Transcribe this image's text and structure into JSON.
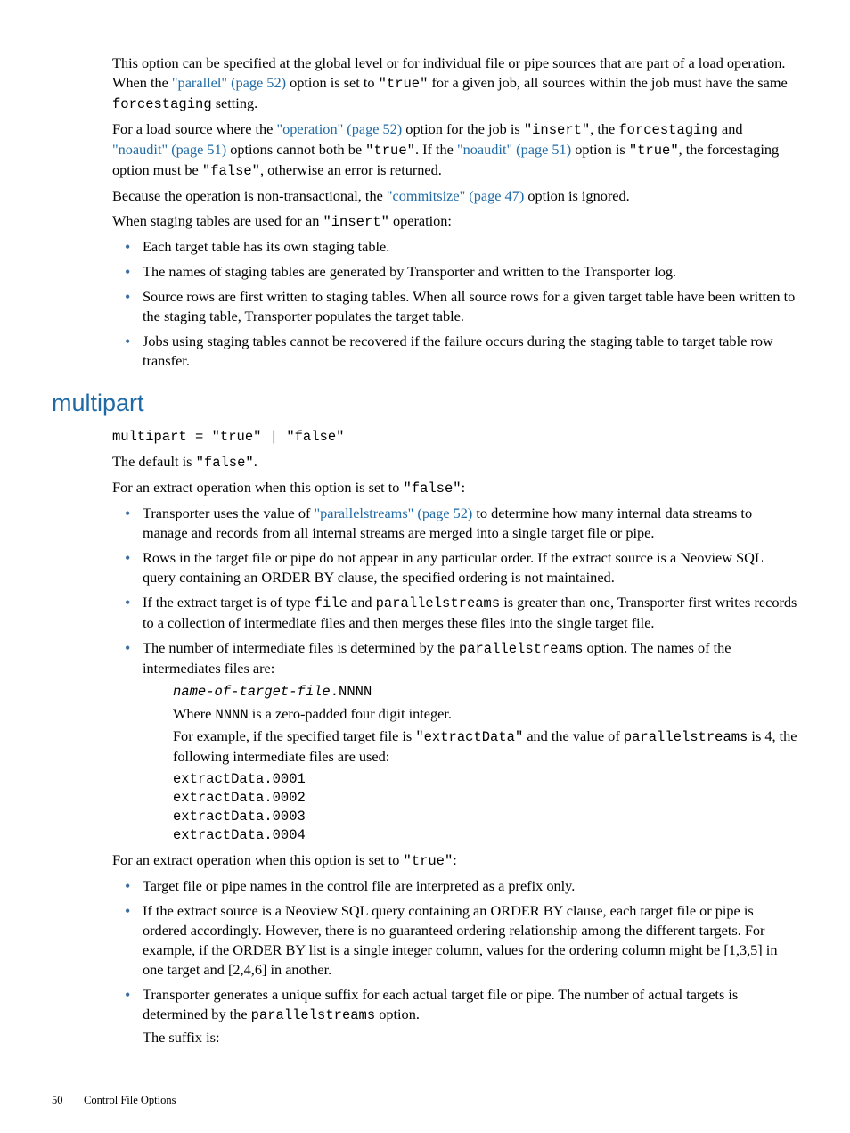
{
  "para1": {
    "t1": "This option can be specified at the global level or for individual file or pipe sources that are part of a load operation. When the ",
    "link1": "\"parallel\" (page 52)",
    "t2": " option is set to ",
    "code1": "\"true\"",
    "t3": " for a given job, all sources within the job must have the same ",
    "code2": "forcestaging",
    "t4": " setting."
  },
  "para2": {
    "t1": "For a load source where the ",
    "link1": "\"operation\" (page 52)",
    "t2": " option for the job is ",
    "code1": "\"insert\"",
    "t3": ", the ",
    "code2": "forcestaging",
    "t4": " and ",
    "link2": "\"noaudit\" (page 51)",
    "t5": " options cannot both be ",
    "code3": "\"true\"",
    "t6": ". If the ",
    "link3": "\"noaudit\" (page 51)",
    "t7": " option is ",
    "code4": "\"true\"",
    "t8": ", the forcestaging option must be ",
    "code5": "\"false\"",
    "t9": ", otherwise an error is returned."
  },
  "para3": {
    "t1": "Because the operation is non-transactional, the ",
    "link1": "\"commitsize\" (page 47)",
    "t2": " option is ignored."
  },
  "para4": {
    "t1": "When staging tables are used for an ",
    "code1": "\"insert\"",
    "t2": " operation:"
  },
  "list1": {
    "i1": "Each target table has its own staging table.",
    "i2": "The names of staging tables are generated by Transporter and written to the Transporter log.",
    "i3": "Source rows are first written to staging tables. When all source rows for a given target table have been written to the staging table, Transporter populates the target table.",
    "i4": "Jobs using staging tables cannot be recovered if the failure occurs during the staging table to target table row transfer."
  },
  "section_heading": "multipart",
  "syntax": "multipart = \"true\" | \"false\"",
  "default": {
    "t1": "The default is ",
    "code1": "\"false\"",
    "t2": "."
  },
  "false_intro": {
    "t1": "For an extract operation when this option is set to ",
    "code1": "\"false\"",
    "t2": ":"
  },
  "list2": {
    "i1": {
      "t1": "Transporter uses the value of ",
      "link1": "\"parallelstreams\" (page 52)",
      "t2": " to determine how many internal data streams to manage and records from all internal streams are merged into a single target file or pipe."
    },
    "i2": "Rows in the target file or pipe do not appear in any particular order. If the extract source is a Neoview SQL query containing an ORDER BY clause, the specified ordering is not maintained.",
    "i3": {
      "t1": "If the extract target is of type ",
      "c1": "file",
      "t2": " and ",
      "c2": "parallelstreams",
      "t3": " is greater than one, Transporter first writes records to a collection of intermediate files and then merges these files into the single target file."
    },
    "i4": {
      "t1": "The number of intermediate files is determined by the ",
      "c1": "parallelstreams",
      "t2": " option. The names of the intermediates files are:"
    }
  },
  "name_pattern_prefix": "name-of-target-file",
  "name_pattern_suffix": ".NNNN",
  "where_line": {
    "t1": "Where ",
    "c1": "NNNN",
    "t2": " is a zero-padded four digit integer."
  },
  "example_intro": {
    "t1": "For example, if the specified target file is ",
    "c1": "\"extractData\"",
    "t2": " and the value of ",
    "c2": "parallelstreams",
    "t3": " is 4, the following intermediate files are used:"
  },
  "example_files": "extractData.0001\nextractData.0002\nextractData.0003\nextractData.0004",
  "true_intro": {
    "t1": "For an extract operation when this option is set to ",
    "code1": "\"true\"",
    "t2": ":"
  },
  "list3": {
    "i1": "Target file or pipe names in the control file are interpreted as a prefix only.",
    "i2": "If the extract source is a Neoview SQL query containing an ORDER BY clause, each target file or pipe is ordered accordingly. However, there is no guaranteed ordering relationship among the different targets. For example, if the ORDER BY list is a single integer column, values for the ordering column might be [1,3,5] in one target and [2,4,6] in another.",
    "i3": {
      "t1": "Transporter generates a unique suffix for each actual target file or pipe. The number of actual targets is determined by the ",
      "c1": "parallelstreams",
      "t2": " option."
    },
    "i3sub": "The suffix is:"
  },
  "footer": {
    "page": "50",
    "title": "Control File Options"
  }
}
